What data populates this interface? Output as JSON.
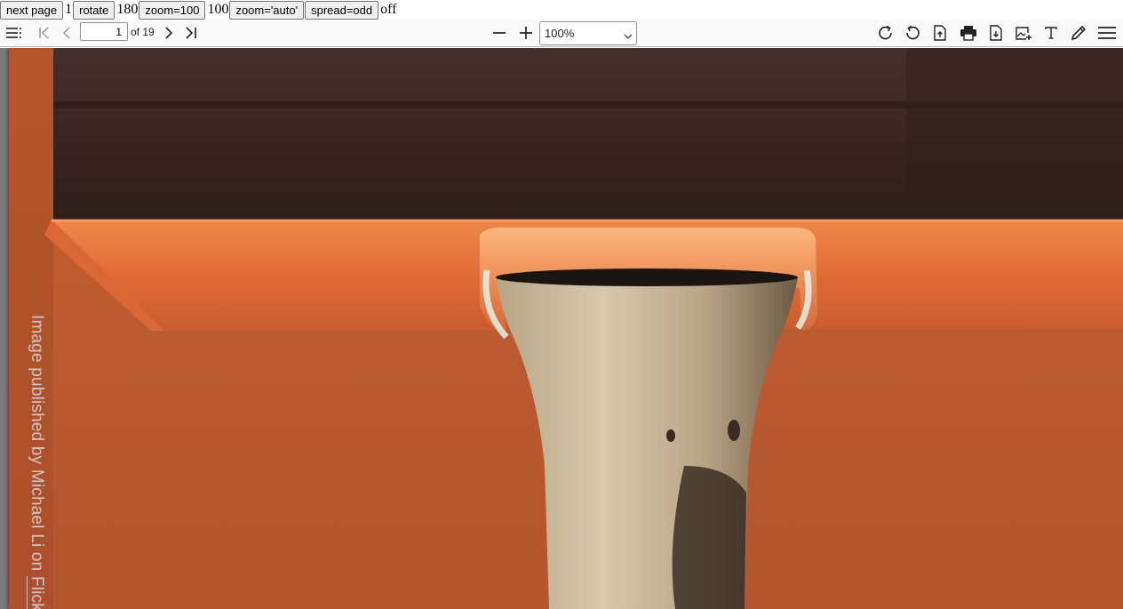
{
  "harness": {
    "next_page_label": "next page",
    "page_value": "1",
    "rotate_label": "rotate",
    "rotate_value": "180",
    "zoom100_label": "zoom=100",
    "zoom_value": "100",
    "zoom_auto_label": "zoom='auto'",
    "spread_label": "spread=odd",
    "spread_value": "off"
  },
  "toolbar": {
    "page_number": "1",
    "page_count": "of 19",
    "zoom_selected": "100%",
    "icons": {
      "sidebar": "sidebar-toggle-icon",
      "first": "first-page-icon",
      "previous": "previous-page-icon",
      "next": "next-page-icon",
      "last": "last-page-icon",
      "zoom_out": "zoom-out-icon",
      "zoom_in": "zoom-in-icon",
      "rotate_cw": "rotate-clockwise-icon",
      "rotate_ccw": "rotate-counterclockwise-icon",
      "open": "open-file-icon",
      "print": "print-icon",
      "download": "download-icon",
      "stamp": "add-image-icon",
      "text": "text-annotation-icon",
      "draw": "draw-pen-icon",
      "menu": "hamburger-menu-icon"
    }
  },
  "document": {
    "credit_prefix": "Image published by Michael Li on ",
    "credit_link": "Flickr",
    "colors": {
      "background": "#bd5c30",
      "ledge": "#e8743c",
      "dark_band": "#3a2620",
      "vessel": "#c7b595"
    }
  }
}
